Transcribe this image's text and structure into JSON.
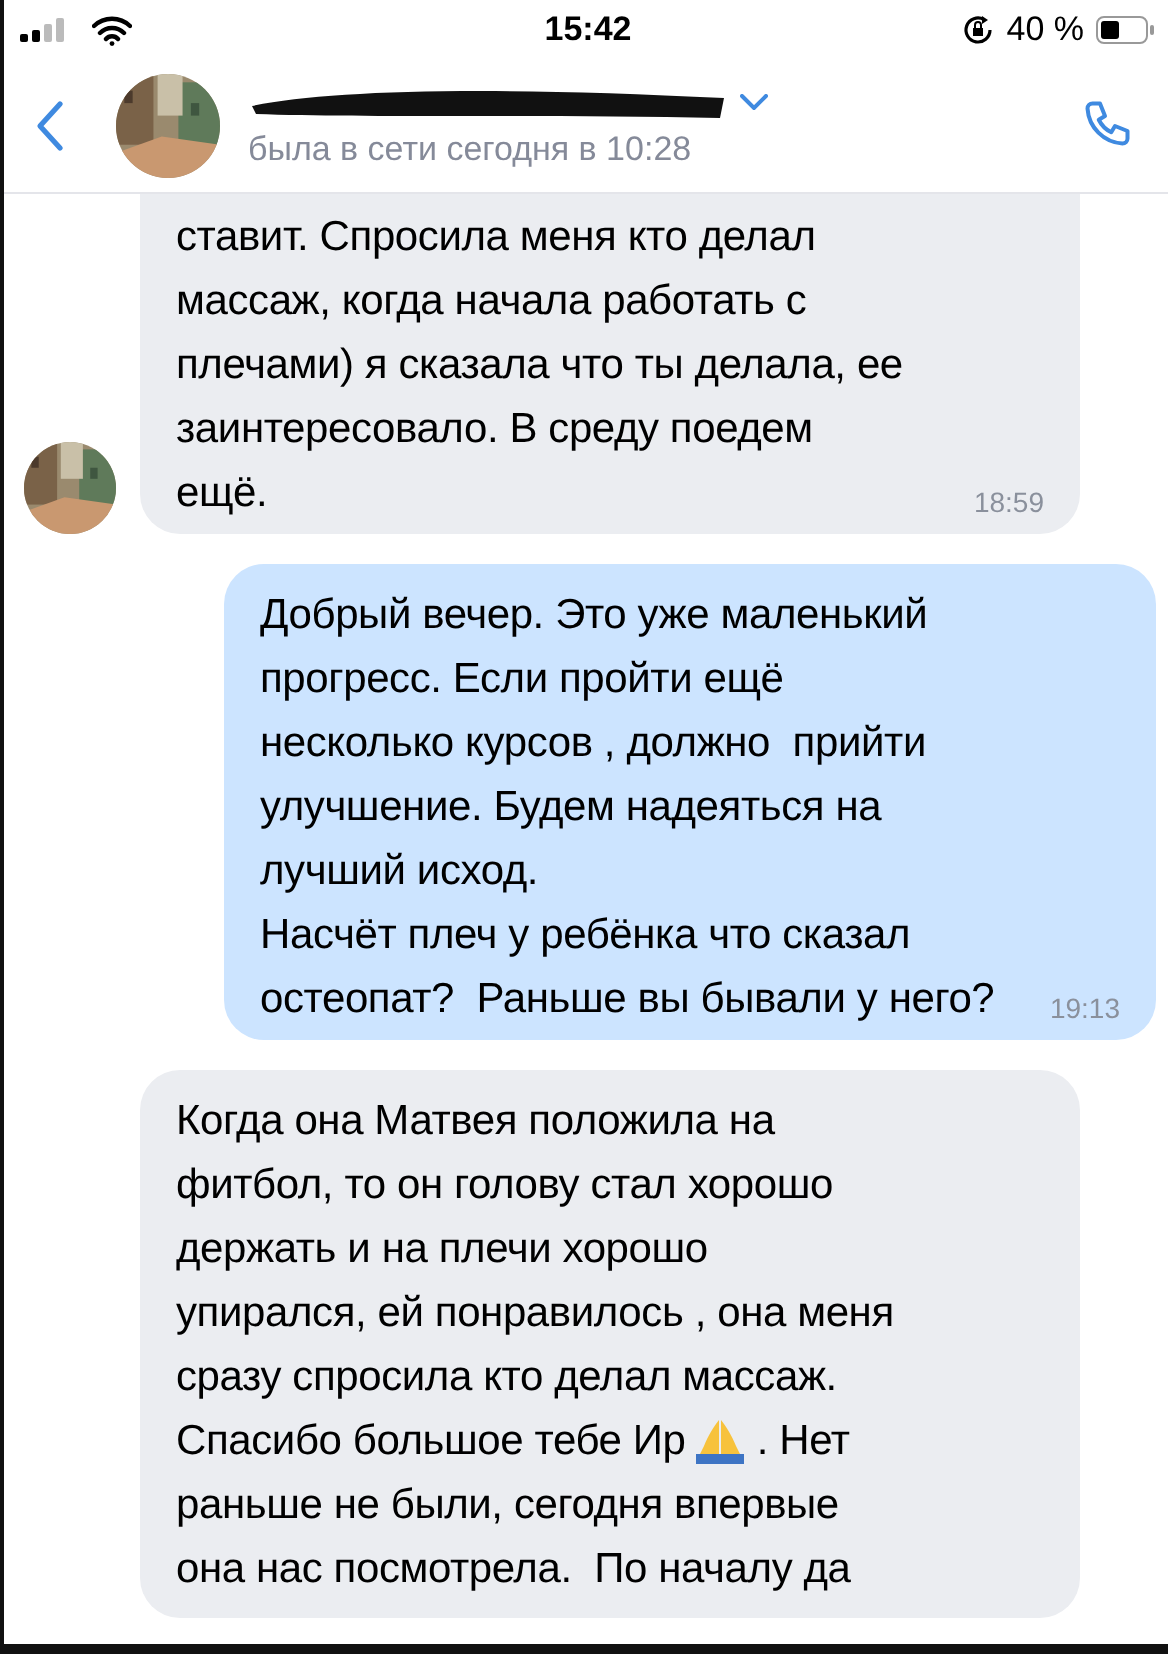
{
  "status_bar": {
    "time": "15:42",
    "battery": "40 %"
  },
  "header": {
    "status": "была в сети сегодня в 10:28",
    "name_redacted": true
  },
  "messages": [
    {
      "kind": "incoming",
      "avatar": true,
      "clipped_top": true,
      "blocks": [
        {
          "kind": "text",
          "text": "ставит. Спросила меня кто делал\nмассаж, когда начала работать с\nплечами) я сказала что ты делала, ее\nзаинтересовало. В среду поедем\nещё."
        }
      ],
      "time": "18:59"
    },
    {
      "kind": "outgoing",
      "avatar": false,
      "clipped_top": false,
      "blocks": [
        {
          "kind": "text",
          "text": "Добрый вечер. Это уже маленький\nпрогресс. Если пройти ещё\nнесколько курсов , должно  прийти\nулучшение. Будем надеяться на\nлучший исход.\nНасчёт плеч у ребёнка что сказал\nостеопат?  Раньше вы бывали у него?"
        }
      ],
      "time": "19:13"
    },
    {
      "kind": "incoming",
      "avatar": false,
      "clipped_top": false,
      "blocks": [
        {
          "kind": "text",
          "text": "Когда она Матвея положила на\nфитбол, то он голову стал хорошо\nдержать и на плечи хорошо\nупирался, ей понравилось , она меня\nсразу спросила кто делал массаж."
        },
        {
          "kind": "emoji_line",
          "before": "Спасибо большое тебе Ир",
          "after": " . Нет"
        },
        {
          "kind": "text",
          "text": "раньше не были, сегодня впервые\nона нас посмотрела.  По началу да"
        }
      ]
    }
  ]
}
